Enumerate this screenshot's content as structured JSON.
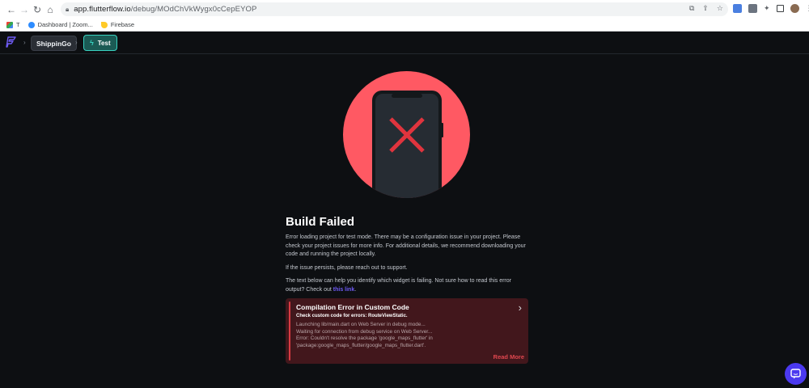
{
  "browser": {
    "url_host": "app.flutterflow.io",
    "url_path": "/debug/MOdChVkWygx0cCepEYOP"
  },
  "bookmarks": [
    {
      "label": "T",
      "icon": "google-apps-icon"
    },
    {
      "label": "Dashboard | Zoom...",
      "icon": "zoom-icon"
    },
    {
      "label": "Firebase",
      "icon": "firebase-icon"
    }
  ],
  "header": {
    "project": "ShippinGo",
    "mode": "Test"
  },
  "main": {
    "title": "Build Failed",
    "para1": "Error loading project for test mode. There may be a configuration issue in your project. Please check your project issues for more info. For additional details, we recommend downloading your code and running the project locally.",
    "para2": "If the issue persists, please reach out to support.",
    "para3_prefix": "The text below can help you identify which widget is failing. Not sure how to read this error output? Check out ",
    "link_text": "this link",
    "para3_suffix": "."
  },
  "error": {
    "title": "Compilation Error in Custom Code",
    "subtitle": "Check custom code for errors: RouteViewStatic.",
    "lines": [
      "Launching lib/main.dart on Web Server in debug mode...",
      "Waiting for connection from debug service on Web Server...",
      "Error: Couldn't resolve the package 'google_maps_flutter' in 'package:google_maps_flutter/google_maps_flutter.dart'."
    ],
    "read_more": "Read More"
  },
  "colors": {
    "accent": "#4b39ef",
    "test_teal": "#39d2c0",
    "error_red": "#ff5963",
    "card_bg": "#42171c"
  }
}
